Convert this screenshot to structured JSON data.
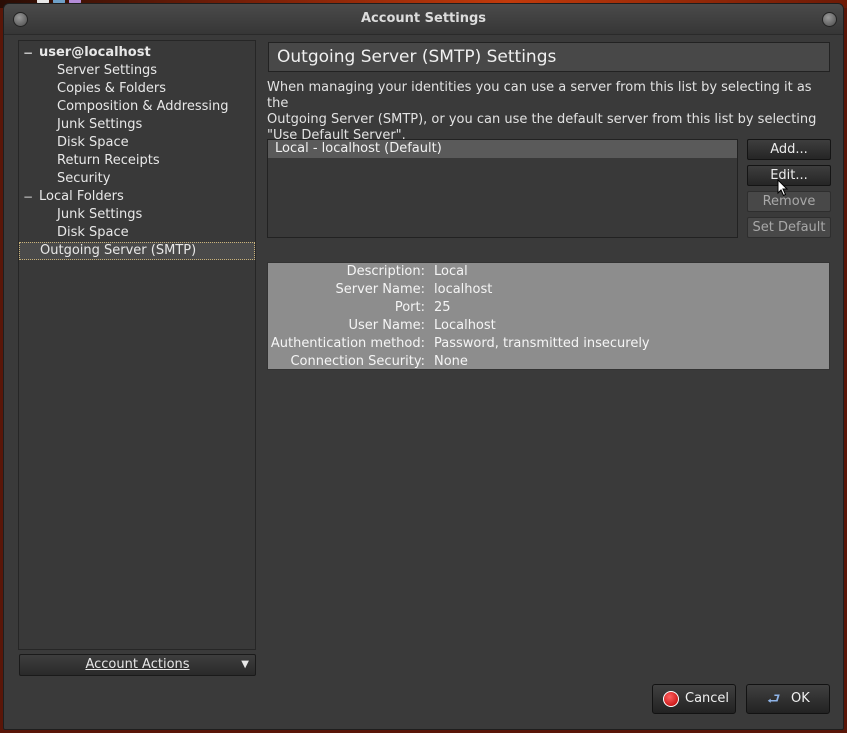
{
  "window": {
    "title": "Account Settings"
  },
  "tree": [
    {
      "label": "user@localhost",
      "level": 0,
      "expanded": true,
      "bold": true
    },
    {
      "label": "Server Settings",
      "level": 1
    },
    {
      "label": "Copies & Folders",
      "level": 1
    },
    {
      "label": "Composition & Addressing",
      "level": 1
    },
    {
      "label": "Junk Settings",
      "level": 1
    },
    {
      "label": "Disk Space",
      "level": 1
    },
    {
      "label": "Return Receipts",
      "level": 1
    },
    {
      "label": "Security",
      "level": 1
    },
    {
      "label": "Local Folders",
      "level": 0,
      "expanded": true
    },
    {
      "label": "Junk Settings",
      "level": 1
    },
    {
      "label": "Disk Space",
      "level": 1
    },
    {
      "label": "Outgoing Server (SMTP)",
      "level": 0,
      "selected": true
    }
  ],
  "twisty_symbol": "−",
  "account_actions": {
    "label": "Account Actions",
    "arrow": "▼"
  },
  "panel": {
    "title": "Outgoing Server (SMTP) Settings",
    "description_lines": [
      "When managing your identities you can use a server from this list by selecting it as the",
      "Outgoing Server (SMTP), or you can use the default server from this list by selecting",
      "\"Use Default Server\"."
    ]
  },
  "servers": [
    "Local - localhost (Default)"
  ],
  "buttons": {
    "add": "Add...",
    "edit": "Edit...",
    "remove": "Remove",
    "set_default": "Set Default"
  },
  "details": [
    {
      "label": "Description:",
      "value": "Local"
    },
    {
      "label": "Server Name:",
      "value": "localhost"
    },
    {
      "label": "Port:",
      "value": "25"
    },
    {
      "label": "User Name:",
      "value": "Localhost"
    },
    {
      "label": "Authentication method:",
      "value": "Password, transmitted insecurely"
    },
    {
      "label": "Connection Security:",
      "value": "None"
    }
  ],
  "dialog": {
    "cancel": "Cancel",
    "ok": "OK"
  },
  "colors": {
    "selection_border": "#c9b27a",
    "details_bg": "#8d8d8d",
    "cancel_icon": "#d00000"
  }
}
